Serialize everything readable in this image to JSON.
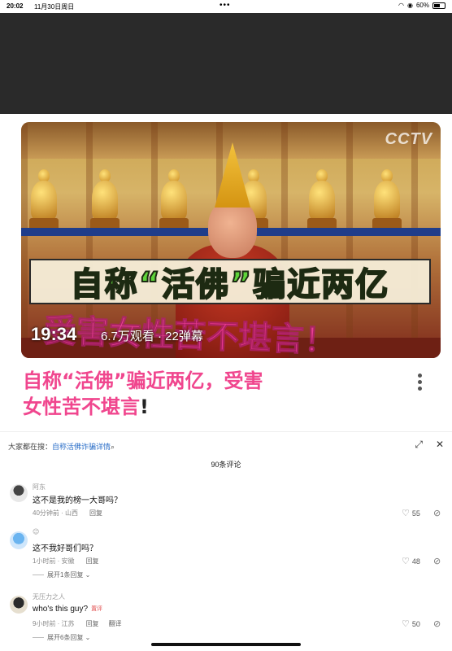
{
  "status_bar": {
    "time": "20:02",
    "date": "11月30日周日",
    "battery": "60%",
    "battery_level": 0.6
  },
  "video": {
    "watermark": "CCTV",
    "headline_overlay": "自称“活佛”骗近两亿",
    "subtitle_overlay": "受害女性苦不堪言！",
    "duration": "19:34",
    "views_danmaku": "6.7万观看 · 22弹幕"
  },
  "title": {
    "line1": "自称“活佛”骗近两亿，受害",
    "line2": "女性苦不堪言",
    "line2_punct": "!"
  },
  "search_bar": {
    "prefix": "大家都在搜：",
    "link": "自称活佛诈骗详情"
  },
  "comments_header": {
    "count": "90条评论"
  },
  "comments": [
    {
      "name": "阿东",
      "text": "这不是我的榜一大哥吗？",
      "meta": "40分钟前 · 山西",
      "reply": "回复",
      "likes": "55"
    },
    {
      "name": "",
      "text": "这不我好哥们吗？",
      "meta": "1小时前 · 安徽",
      "reply": "回复",
      "likes": "48",
      "expand": "展开1条回复"
    },
    {
      "name": "无压力之人",
      "text": "who's this guy?",
      "tag": "置评",
      "meta": "9小时前 · 江苏",
      "reply": "回复",
      "translate": "翻译",
      "likes": "50",
      "expand": "展开6条回复"
    }
  ],
  "colors": {
    "title_pink": "#f0468e",
    "headline_green": "#5ed33a",
    "link_blue": "#2c6fc8"
  },
  "icons": [
    "wifi-icon",
    "battery-icon",
    "more-icon",
    "share-icon",
    "close-icon",
    "heart-icon",
    "dislike-icon"
  ]
}
